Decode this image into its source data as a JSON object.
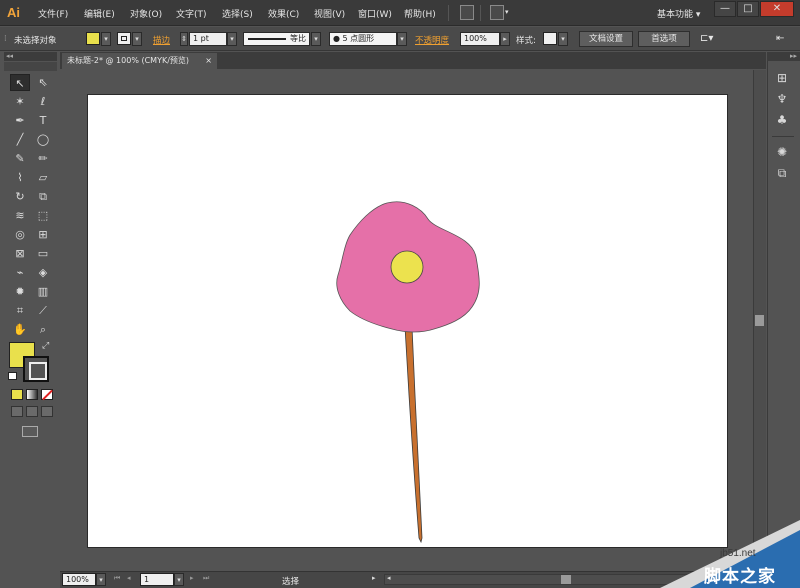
{
  "app": {
    "logo": "Ai"
  },
  "menu": [
    {
      "label": "文件(F)"
    },
    {
      "label": "编辑(E)"
    },
    {
      "label": "对象(O)"
    },
    {
      "label": "文字(T)"
    },
    {
      "label": "选择(S)"
    },
    {
      "label": "效果(C)"
    },
    {
      "label": "视图(V)"
    },
    {
      "label": "窗口(W)"
    },
    {
      "label": "帮助(H)"
    }
  ],
  "workspace": {
    "label": "基本功能",
    "arrow": "▾"
  },
  "window_controls": {
    "minimize": "—",
    "maximize": "□",
    "close": "✕"
  },
  "control_bar": {
    "selection_label": "未选择对象",
    "stroke_label": "描边",
    "stroke_weight": "1 pt",
    "profile_label": "等比",
    "brush_label": "5 点圆形",
    "opacity_label": "不透明度",
    "opacity_value": "100%",
    "style_label": "样式:",
    "doc_setup_label": "文档设置",
    "preferences_label": "首选项",
    "fill_color": "#e9e04c"
  },
  "document": {
    "tab_title": "未标题-2* @ 100% (CMYK/预览)",
    "tab_close": "×"
  },
  "artwork": {
    "petal_color": "#e570a8",
    "center_color": "#ece24e",
    "stem_color": "#c8702e"
  },
  "toolbox": {
    "fill_color": "#e9e04c",
    "swap_icon": "⤢",
    "tools": [
      {
        "name": "selection-tool",
        "glyph": "↖"
      },
      {
        "name": "direct-selection-tool",
        "glyph": "⇖"
      },
      {
        "name": "magic-wand-tool",
        "glyph": "✶"
      },
      {
        "name": "lasso-tool",
        "glyph": "ℓ"
      },
      {
        "name": "pen-tool",
        "glyph": "✒"
      },
      {
        "name": "type-tool",
        "glyph": "T"
      },
      {
        "name": "line-tool",
        "glyph": "╱"
      },
      {
        "name": "ellipse-tool",
        "glyph": "◯"
      },
      {
        "name": "paintbrush-tool",
        "glyph": "✎"
      },
      {
        "name": "pencil-tool",
        "glyph": "✏"
      },
      {
        "name": "blob-brush-tool",
        "glyph": "⌇"
      },
      {
        "name": "eraser-tool",
        "glyph": "▱"
      },
      {
        "name": "rotate-tool",
        "glyph": "↻"
      },
      {
        "name": "scale-tool",
        "glyph": "⧉"
      },
      {
        "name": "warp-tool",
        "glyph": "≋"
      },
      {
        "name": "free-transform-tool",
        "glyph": "⬚"
      },
      {
        "name": "shape-builder-tool",
        "glyph": "◎"
      },
      {
        "name": "perspective-grid-tool",
        "glyph": "⊞"
      },
      {
        "name": "mesh-tool",
        "glyph": "⊠"
      },
      {
        "name": "gradient-tool",
        "glyph": "▭"
      },
      {
        "name": "eyedropper-tool",
        "glyph": "⌁"
      },
      {
        "name": "blend-tool",
        "glyph": "◈"
      },
      {
        "name": "symbol-sprayer-tool",
        "glyph": "✹"
      },
      {
        "name": "column-graph-tool",
        "glyph": "▥"
      },
      {
        "name": "artboard-tool",
        "glyph": "⌗"
      },
      {
        "name": "slice-tool",
        "glyph": "⟋"
      },
      {
        "name": "hand-tool",
        "glyph": "✋"
      },
      {
        "name": "zoom-tool",
        "glyph": "⌕"
      }
    ]
  },
  "status_bar": {
    "zoom": "100%",
    "artboard_number": "1",
    "status_text": "选择"
  },
  "watermark": {
    "site": "jb51.net",
    "name": "脚本之家"
  }
}
